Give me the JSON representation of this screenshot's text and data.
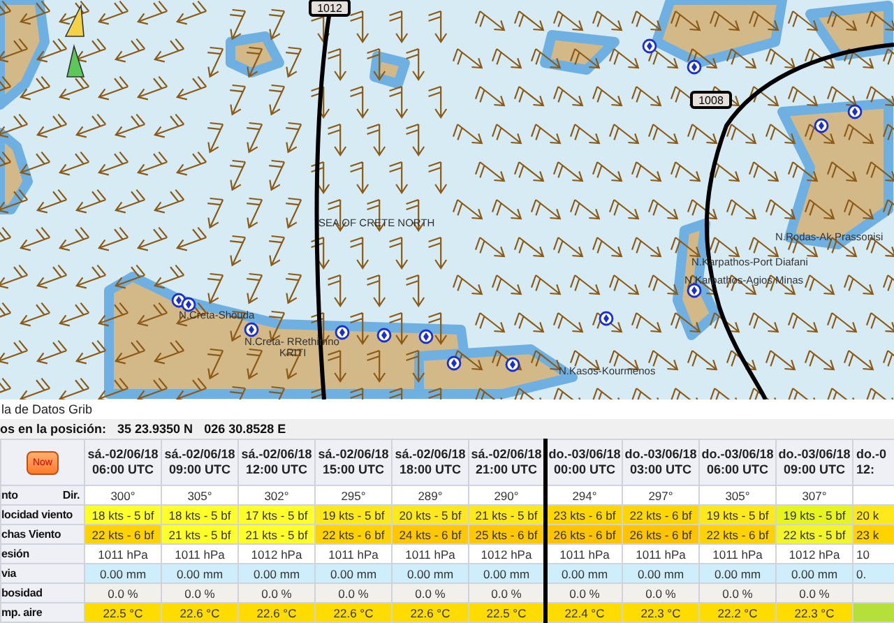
{
  "map": {
    "isobars": [
      {
        "label": "1012"
      },
      {
        "label": "1008"
      }
    ],
    "place_labels": [
      {
        "text": "SEA OF CRETE NORTH"
      },
      {
        "text": "N.Creta-Shouda"
      },
      {
        "text": "N.Creta- RRethimno"
      },
      {
        "text": "KRITI"
      },
      {
        "text": "N.Karpathos-Port Diafani"
      },
      {
        "text": "N.Karpathos-Agios Minas"
      },
      {
        "text": "N.Rodas-Ak Prassonisi"
      },
      {
        "text": "N.Kasos-Kourmenos"
      }
    ]
  },
  "grib_panel": {
    "title": "la de Datos Grib",
    "position_label": "os en la posición:",
    "latitude": "35 23.9350 N",
    "longitude": "026 30.8528 E",
    "now_button": "Now",
    "columns": [
      {
        "date": "sá.-02/06/18",
        "time": "06:00  UTC",
        "day_start": false
      },
      {
        "date": "sá.-02/06/18",
        "time": "09:00  UTC",
        "day_start": false
      },
      {
        "date": "sá.-02/06/18",
        "time": "12:00  UTC",
        "day_start": false
      },
      {
        "date": "sá.-02/06/18",
        "time": "15:00  UTC",
        "day_start": false
      },
      {
        "date": "sá.-02/06/18",
        "time": "18:00  UTC",
        "day_start": false
      },
      {
        "date": "sá.-02/06/18",
        "time": "21:00  UTC",
        "day_start": false
      },
      {
        "date": "do.-03/06/18",
        "time": "00:00  UTC",
        "day_start": true
      },
      {
        "date": "do.-03/06/18",
        "time": "03:00  UTC",
        "day_start": false
      },
      {
        "date": "do.-03/06/18",
        "time": "06:00  UTC",
        "day_start": false
      },
      {
        "date": "do.-03/06/18",
        "time": "09:00  UTC",
        "day_start": false
      },
      {
        "date": "do.-0",
        "time": "12:",
        "day_start": false
      }
    ],
    "rows": [
      {
        "label": "nto",
        "sublabel": "Dir.",
        "color": "#ffffff",
        "cells": [
          {
            "text": "300°"
          },
          {
            "text": "305°"
          },
          {
            "text": "302°"
          },
          {
            "text": "295°"
          },
          {
            "text": "289°"
          },
          {
            "text": "290°"
          },
          {
            "text": "294°"
          },
          {
            "text": "297°"
          },
          {
            "text": "305°"
          },
          {
            "text": "307°"
          },
          {
            "text": null
          }
        ]
      },
      {
        "label": "locidad viento",
        "cells": [
          {
            "text": "18 kts -  5 bf",
            "color": "#ffff2a"
          },
          {
            "text": "18 kts -  5 bf",
            "color": "#ffff2a"
          },
          {
            "text": "17 kts -  5 bf",
            "color": "#ffff2a"
          },
          {
            "text": "19 kts -  5 bf",
            "color": "#ffe81c"
          },
          {
            "text": "20 kts -  5 bf",
            "color": "#ffe81c"
          },
          {
            "text": "21 kts -  5 bf",
            "color": "#ffe81c"
          },
          {
            "text": "23 kts -  6 bf",
            "color": "#ffd700"
          },
          {
            "text": "22 kts -  6 bf",
            "color": "#ffd700"
          },
          {
            "text": "19 kts -  5 bf",
            "color": "#ffe81c"
          },
          {
            "text": "19 kts -  5 bf",
            "color": "#e6f51e"
          },
          {
            "text": "20 k",
            "color": "#ffe81c"
          }
        ]
      },
      {
        "label": "chas Viento",
        "cells": [
          {
            "text": "22 kts -  6 bf",
            "color": "#ffd200"
          },
          {
            "text": "21 kts -  5 bf",
            "color": "#ffff2a"
          },
          {
            "text": "21 kts -  5 bf",
            "color": "#ffff2a"
          },
          {
            "text": "22 kts -  6 bf",
            "color": "#ffd200"
          },
          {
            "text": "24 kts -  6 bf",
            "color": "#ffc800"
          },
          {
            "text": "25 kts -  6 bf",
            "color": "#ffc800"
          },
          {
            "text": "26 kts -  6 bf",
            "color": "#ffc400"
          },
          {
            "text": "26 kts -  6 bf",
            "color": "#ffc400"
          },
          {
            "text": "22 kts -  6 bf",
            "color": "#ffd200"
          },
          {
            "text": "22 kts -  5 bf",
            "color": "#f2f52a"
          },
          {
            "text": "23 k",
            "color": "#ffd200"
          }
        ]
      },
      {
        "label": "esión",
        "color": "#ffffff",
        "cells": [
          {
            "text": "1011 hPa"
          },
          {
            "text": "1011 hPa"
          },
          {
            "text": "1012 hPa"
          },
          {
            "text": "1011 hPa"
          },
          {
            "text": "1011 hPa"
          },
          {
            "text": "1012 hPa"
          },
          {
            "text": "1011 hPa"
          },
          {
            "text": "1011 hPa"
          },
          {
            "text": "1011 hPa"
          },
          {
            "text": "1012 hPa"
          },
          {
            "text": "10"
          }
        ]
      },
      {
        "label": "via",
        "color": "#cfeefb",
        "cells": [
          {
            "text": "0.00 mm"
          },
          {
            "text": "0.00 mm"
          },
          {
            "text": "0.00 mm"
          },
          {
            "text": "0.00 mm"
          },
          {
            "text": "0.00 mm"
          },
          {
            "text": "0.00 mm"
          },
          {
            "text": "0.00 mm"
          },
          {
            "text": "0.00 mm"
          },
          {
            "text": "0.00 mm"
          },
          {
            "text": "0.00 mm"
          },
          {
            "text": "0."
          }
        ]
      },
      {
        "label": "bosidad",
        "color": "#f1f0ea",
        "cells": [
          {
            "text": "0.0 %"
          },
          {
            "text": "0.0 %"
          },
          {
            "text": "0.0 %"
          },
          {
            "text": "0.0 %"
          },
          {
            "text": "0.0 %"
          },
          {
            "text": "0.0 %"
          },
          {
            "text": "0.0 %"
          },
          {
            "text": "0.0 %"
          },
          {
            "text": "0.0 %"
          },
          {
            "text": "0.0 %"
          },
          {
            "text": null
          }
        ]
      },
      {
        "label": "mp. aire",
        "color": "#ffdc00",
        "cells": [
          {
            "text": "22.5 °C"
          },
          {
            "text": "22.6 °C"
          },
          {
            "text": "22.6 °C"
          },
          {
            "text": "22.6 °C"
          },
          {
            "text": "22.6 °C"
          },
          {
            "text": "22.5 °C"
          },
          {
            "text": "22.4 °C"
          },
          {
            "text": "22.3 °C"
          },
          {
            "text": "22.2 °C"
          },
          {
            "text": "22.3 °C"
          },
          {
            "text": null,
            "color": "#b5e03a"
          }
        ]
      }
    ]
  }
}
